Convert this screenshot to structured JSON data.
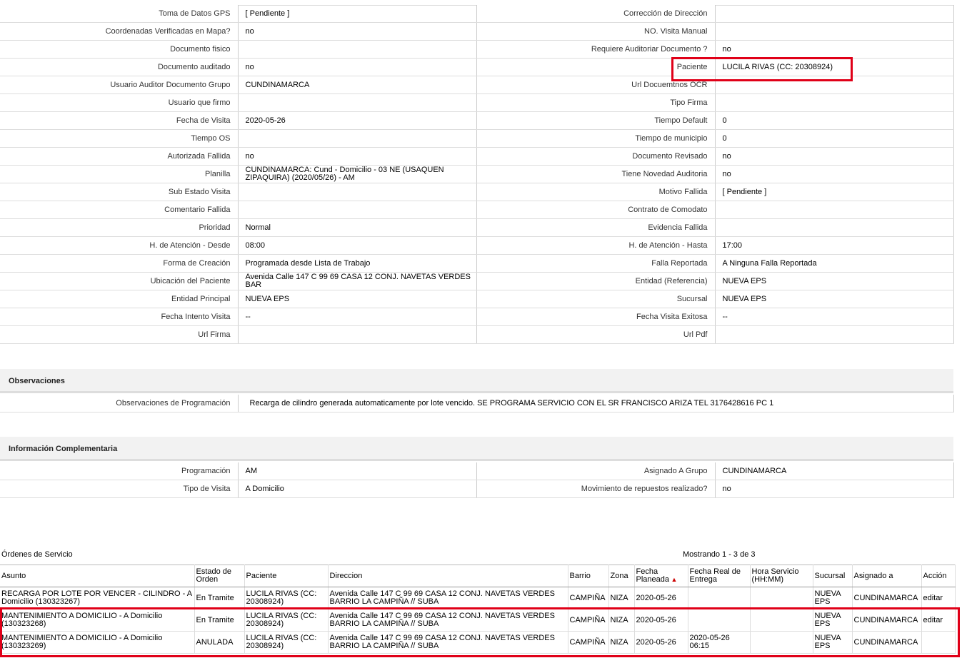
{
  "details": [
    {
      "l1": "Toma de Datos GPS",
      "v1": "[ Pendiente ]",
      "l2": "Corrección de Dirección",
      "v2": ""
    },
    {
      "l1": "Coordenadas Verificadas en Mapa?",
      "v1": "no",
      "l2": "NO. Visita Manual",
      "v2": ""
    },
    {
      "l1": "Documento fisico",
      "v1": "",
      "l2": "Requiere Auditoriar Documento ?",
      "v2": "no"
    },
    {
      "l1": "Documento auditado",
      "v1": "no",
      "l2": "Paciente",
      "v2": "LUCILA RIVAS (CC: 20308924)"
    },
    {
      "l1": "Usuario Auditor Documento Grupo",
      "v1": "CUNDINAMARCA",
      "l2": "Url Docuemtnos OCR",
      "v2": ""
    },
    {
      "l1": "Usuario que firmo",
      "v1": "",
      "l2": "Tipo Firma",
      "v2": ""
    },
    {
      "l1": "Fecha de Visita",
      "v1": "2020-05-26",
      "l2": "Tiempo Default",
      "v2": "0"
    },
    {
      "l1": "Tiempo OS",
      "v1": "",
      "l2": "Tiempo de municipio",
      "v2": "0"
    },
    {
      "l1": "Autorizada Fallida",
      "v1": "no",
      "l2": "Documento Revisado",
      "v2": "no"
    },
    {
      "l1": "Planilla",
      "v1": "CUNDINAMARCA: Cund - Domicilio - 03 NE (USAQUEN ZIPAQUIRA) (2020/05/26) - AM",
      "l2": "Tiene Novedad Auditoria",
      "v2": "no"
    },
    {
      "l1": "Sub Estado Visita",
      "v1": "",
      "l2": "Motivo Fallida",
      "v2": "[ Pendiente ]"
    },
    {
      "l1": "Comentario Fallida",
      "v1": "",
      "l2": "Contrato de Comodato",
      "v2": ""
    },
    {
      "l1": "Prioridad",
      "v1": "Normal",
      "l2": "Evidencia Fallida",
      "v2": ""
    },
    {
      "l1": "H. de Atención - Desde",
      "v1": "08:00",
      "l2": "H. de Atención - Hasta",
      "v2": "17:00"
    },
    {
      "l1": "Forma de Creación",
      "v1": "Programada desde Lista de Trabajo",
      "l2": "Falla Reportada",
      "v2": "A Ninguna Falla Reportada"
    },
    {
      "l1": "Ubicación del Paciente",
      "v1": "Avenida Calle 147 C 99 69 CASA 12 CONJ. NAVETAS VERDES BAR",
      "l2": "Entidad (Referencia)",
      "v2": "NUEVA EPS"
    },
    {
      "l1": "Entidad Principal",
      "v1": "NUEVA EPS",
      "l2": "Sucursal",
      "v2": "NUEVA EPS"
    },
    {
      "l1": "Fecha Intento Visita",
      "v1": "--",
      "l2": "Fecha Visita Exitosa",
      "v2": "--"
    },
    {
      "l1": "Url Firma",
      "v1": "",
      "l2": "Url Pdf",
      "v2": ""
    }
  ],
  "observaciones": {
    "title": "Observaciones",
    "label": "Observaciones de Programación",
    "value": "Recarga de cilindro generada automaticamente por lote vencido. SE PROGRAMA SERVICIO CON EL SR FRANCISCO ARIZA TEL 3176428616 PC 1"
  },
  "complementaria": {
    "title": "Información Complementaria",
    "rows": [
      {
        "l1": "Programación",
        "v1": "AM",
        "l2": "Asignado A Grupo",
        "v2": "CUNDINAMARCA"
      },
      {
        "l1": "Tipo de Visita",
        "v1": "A Domicilio",
        "l2": "Movimiento de repuestos realizado?",
        "v2": "no"
      }
    ]
  },
  "orders": {
    "title": "Órdenes de Servicio",
    "showing": "Mostrando 1 - 3 de 3",
    "headers": [
      "Asunto",
      "Estado de Orden",
      "Paciente",
      "Direccion",
      "Barrio",
      "Zona",
      "Fecha Planeada",
      "Fecha Real de Entrega",
      "Hora Servicio (HH:MM)",
      "Sucursal",
      "Asignado a",
      "Acción"
    ],
    "rows": [
      {
        "asunto": "RECARGA POR LOTE POR VENCER - CILINDRO - A Domicilio (130323267)",
        "estado": "En Tramite",
        "paciente": "LUCILA RIVAS (CC: 20308924)",
        "direccion": "Avenida Calle 147 C 99 69 CASA 12 CONJ. NAVETAS VERDES BARRIO LA CAMPIÑA // SUBA",
        "barrio": "CAMPIÑA",
        "zona": "NIZA",
        "fecha": "2020-05-26",
        "real": "",
        "hora": "",
        "sucursal": "NUEVA EPS",
        "asignado": "CUNDINAMARCA",
        "accion": "editar"
      },
      {
        "asunto": "MANTENIMIENTO A DOMICILIO - A Domicilio (130323268)",
        "estado": "En Tramite",
        "paciente": "LUCILA RIVAS (CC: 20308924)",
        "direccion": "Avenida Calle 147 C 99 69 CASA 12 CONJ. NAVETAS VERDES BARRIO LA CAMPIÑA // SUBA",
        "barrio": "CAMPIÑA",
        "zona": "NIZA",
        "fecha": "2020-05-26",
        "real": "",
        "hora": "",
        "sucursal": "NUEVA EPS",
        "asignado": "CUNDINAMARCA",
        "accion": "editar"
      },
      {
        "asunto": "MANTENIMIENTO A DOMICILIO - A Domicilio (130323269)",
        "estado": "ANULADA",
        "paciente": "LUCILA RIVAS (CC: 20308924)",
        "direccion": "Avenida Calle 147 C 99 69 CASA 12 CONJ. NAVETAS VERDES BARRIO LA CAMPIÑA // SUBA",
        "barrio": "CAMPIÑA",
        "zona": "NIZA",
        "fecha": "2020-05-26",
        "real": "2020-05-26 06:15",
        "hora": "",
        "sucursal": "NUEVA EPS",
        "asignado": "CUNDINAMARCA",
        "accion": ""
      }
    ]
  },
  "colors": {
    "highlight": "#e00018"
  }
}
